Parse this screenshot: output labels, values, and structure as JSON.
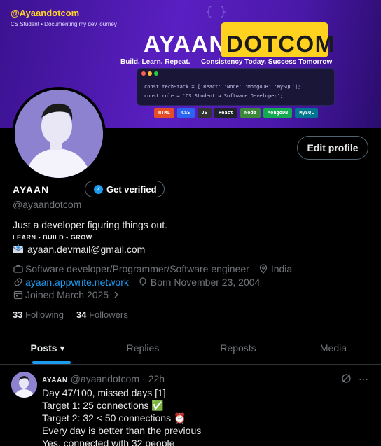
{
  "banner": {
    "handle": "@Ayaandotcom",
    "tagline": "CS Student • Documenting my dev journey",
    "braces": "{ }",
    "name_plain": "AYAAN",
    "name_highlight": "DOTCOM",
    "slogan": "Build. Learn. Repeat. — Consistency Today, Success Tomorrow",
    "code_line1": "const techStack = ['React'  'Node'  'MongoDB'  'MySQL'];",
    "code_line2": "const role = 'CS Student → Software Developer';",
    "chips": [
      "HTML",
      "CSS",
      "JS",
      "React",
      "Node",
      "MongoDB",
      "MySQL"
    ],
    "chip_colors": [
      "#e44d26",
      "#2965f1",
      "#333333",
      "#20232a",
      "#3c873a",
      "#13aa52",
      "#00758f"
    ]
  },
  "profile": {
    "edit_label": "Edit profile",
    "name": "AYAAN",
    "verify_label": "Get verified",
    "handle": "@ayaandotcom",
    "bio": "Just a developer figuring things out.",
    "bio_tag": "LEARN • BUILD • GROW",
    "email": "ayaan.devmail@gmail.com",
    "occupation": "Software developer/Programmer/Software engineer",
    "location": "India",
    "website": "ayaan.appwrite.network",
    "born": "Born November 23, 2004",
    "joined": "Joined March 2025",
    "following_count": "33",
    "following_label": "Following",
    "followers_count": "34",
    "followers_label": "Followers"
  },
  "tabs": [
    {
      "label": "Posts",
      "chevron": "▾"
    },
    {
      "label": "Replies"
    },
    {
      "label": "Reposts"
    },
    {
      "label": "Media"
    }
  ],
  "post": {
    "name": "AYAAN",
    "handle": "@ayaandotcom",
    "dot": "·",
    "time": "22h",
    "more": "···",
    "lines": [
      "Day 47/100,  missed days [1]",
      "Target 1: 25 connections ✅",
      "Target 2: 32 < 50 connections ⏰",
      "Every day is better than the previous",
      "Yes, connected with 32 people"
    ]
  },
  "colors": {
    "accent": "#1d9bf0",
    "highlight_yellow": "#ffd21f",
    "banner_purple": "#5a1fc2"
  }
}
